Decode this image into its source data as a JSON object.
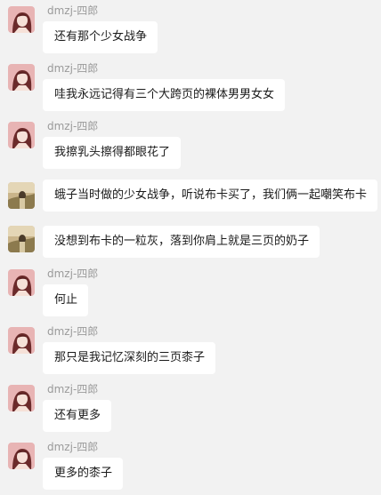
{
  "messages": [
    {
      "sender": "dmzj-四郎",
      "avatar": "girl-avatar-icon",
      "show_sender": true,
      "text": "还有那个少女战争"
    },
    {
      "sender": "dmzj-四郎",
      "avatar": "girl-avatar-icon",
      "show_sender": true,
      "text": "哇我永远记得有三个大跨页的裸体男男女女"
    },
    {
      "sender": "dmzj-四郎",
      "avatar": "girl-avatar-icon",
      "show_sender": true,
      "text": "我擦乳头擦得都眼花了"
    },
    {
      "sender": "",
      "avatar": "landscape-avatar-icon",
      "show_sender": false,
      "text": "蛾子当时做的少女战争，听说布卡买了，我们俩一起嘲笑布卡"
    },
    {
      "sender": "",
      "avatar": "landscape-avatar-icon",
      "show_sender": false,
      "text": "没想到布卡的一粒灰，落到你肩上就是三页的奶子"
    },
    {
      "sender": "dmzj-四郎",
      "avatar": "girl-avatar-icon",
      "show_sender": true,
      "text": "何止"
    },
    {
      "sender": "dmzj-四郎",
      "avatar": "girl-avatar-icon",
      "show_sender": true,
      "text": "那只是我记忆深刻的三页桼子"
    },
    {
      "sender": "dmzj-四郎",
      "avatar": "girl-avatar-icon",
      "show_sender": true,
      "text": "还有更多"
    },
    {
      "sender": "dmzj-四郎",
      "avatar": "girl-avatar-icon",
      "show_sender": true,
      "text": "更多的桼子"
    }
  ],
  "colors": {
    "background": "#f2f2f2",
    "bubble": "#ffffff",
    "sender_text": "#9a9a9a",
    "message_text": "#1a1a1a",
    "girl_avatar_bg": "#e8b4b4",
    "landscape_avatar_bg": "#c9b48a"
  }
}
